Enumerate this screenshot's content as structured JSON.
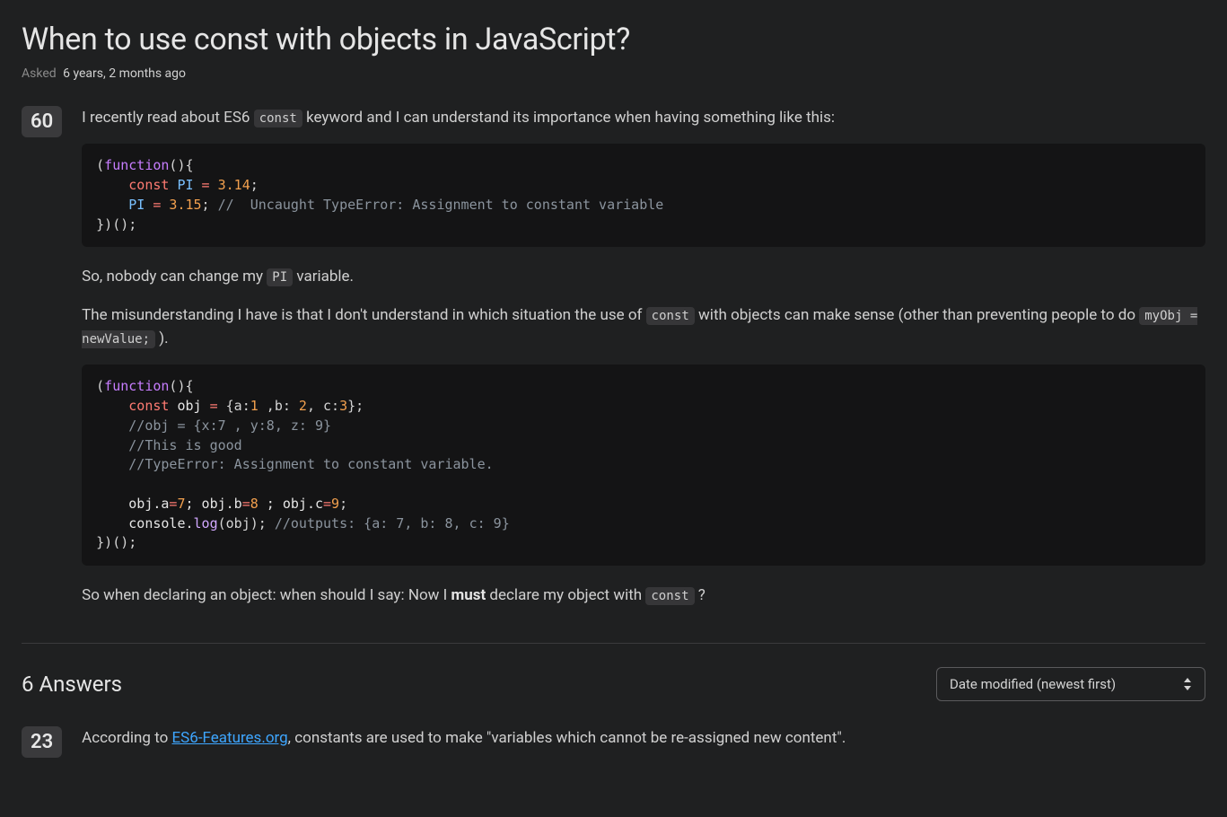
{
  "question": {
    "title": "When to use const with objects in JavaScript?",
    "asked_label": "Asked",
    "asked_value": "6 years, 2 months ago",
    "score": "60",
    "p1_before_code": "I recently read about ES6 ",
    "p1_code": "const",
    "p1_after_code": " keyword and I can understand its importance when having something like this:",
    "code1": {
      "l1_b": "(",
      "l1_fn": "function",
      "l1_c": "(){",
      "l2_a": "    ",
      "l2_kw": "const",
      "l2_b": " PI ",
      "l2_op": "= ",
      "l2_num": "3.14",
      "l2_c": ";",
      "l3_a": "    PI ",
      "l3_op": "= ",
      "l3_num": "3.15",
      "l3_b": "; ",
      "l3_cmt": "//  Uncaught TypeError: Assignment to constant variable",
      "l4": "})();"
    },
    "p2_before": "So, nobody can change my ",
    "p2_code": "PI",
    "p2_after": " variable.",
    "p3_before": "The misunderstanding I have is that I don't understand in which situation the use of ",
    "p3_code1": "const",
    "p3_mid": " with objects can make sense (other than preventing people to do ",
    "p3_code2": "myObj = newValue;",
    "p3_after": " ).",
    "code2": {
      "l1_b": "(",
      "l1_fn": "function",
      "l1_c": "(){",
      "l2_a": "    ",
      "l2_kw": "const",
      "l2_b": " obj ",
      "l2_op": "= ",
      "l2_c": "{a:",
      "l2_n1": "1",
      "l2_d": " ,b: ",
      "l2_n2": "2",
      "l2_e": ", c:",
      "l2_n3": "3",
      "l2_f": "};",
      "l3_a": "    ",
      "l3_cmt": "//obj = {x:7 , y:8, z: 9}",
      "l4_a": "    ",
      "l4_cmt": "//This is good",
      "l5_a": "    ",
      "l5_cmt": "//TypeError: Assignment to constant variable.",
      "l6": "",
      "l7_a": "    obj.a",
      "l7_op1": "=",
      "l7_n1": "7",
      "l7_b": "; obj.b",
      "l7_op2": "=",
      "l7_n2": "8",
      "l7_c": " ; obj.c",
      "l7_op3": "=",
      "l7_n3": "9",
      "l7_d": ";",
      "l8_a": "    console.",
      "l8_fn": "log",
      "l8_b": "(obj); ",
      "l8_cmt": "//outputs: {a: 7, b: 8, c: 9}",
      "l9": "})();"
    },
    "p4_before": "So when declaring an object: when should I say: Now I ",
    "p4_strong": "must",
    "p4_mid": " declare my object with ",
    "p4_code": "const",
    "p4_after": " ?"
  },
  "answers": {
    "heading": "6 Answers",
    "sort_selected": "Date modified (newest first)"
  },
  "answer1": {
    "score": "23",
    "p1_before": "According to ",
    "p1_link": "ES6-Features.org",
    "p1_after": ", constants are used to make \"variables which cannot be re-assigned new content\"."
  }
}
